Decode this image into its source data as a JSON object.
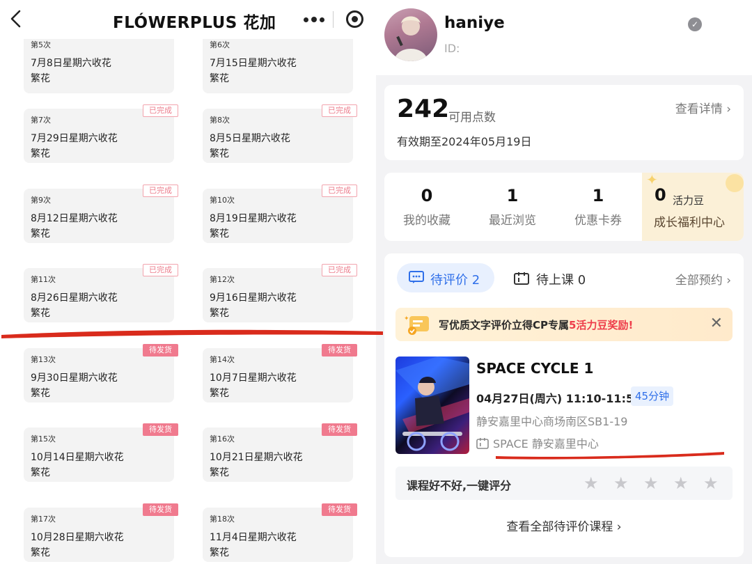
{
  "left": {
    "title": "FLÓWERPLUS 花加",
    "orders": [
      {
        "num": "第5次",
        "date": "7月8日星期六收花",
        "kind": "繁花",
        "status": ""
      },
      {
        "num": "第6次",
        "date": "7月15日星期六收花",
        "kind": "繁花",
        "status": ""
      },
      {
        "num": "第7次",
        "date": "7月29日星期六收花",
        "kind": "繁花",
        "status": "已完成"
      },
      {
        "num": "第8次",
        "date": "8月5日星期六收花",
        "kind": "繁花",
        "status": "已完成"
      },
      {
        "num": "第9次",
        "date": "8月12日星期六收花",
        "kind": "繁花",
        "status": "已完成"
      },
      {
        "num": "第10次",
        "date": "8月19日星期六收花",
        "kind": "繁花",
        "status": "已完成"
      },
      {
        "num": "第11次",
        "date": "8月26日星期六收花",
        "kind": "繁花",
        "status": "已完成"
      },
      {
        "num": "第12次",
        "date": "9月16日星期六收花",
        "kind": "繁花",
        "status": "已完成"
      },
      {
        "num": "第13次",
        "date": "9月30日星期六收花",
        "kind": "繁花",
        "status": "待发货"
      },
      {
        "num": "第14次",
        "date": "10月7日星期六收花",
        "kind": "繁花",
        "status": "待发货"
      },
      {
        "num": "第15次",
        "date": "10月14日星期六收花",
        "kind": "繁花",
        "status": "待发货"
      },
      {
        "num": "第16次",
        "date": "10月21日星期六收花",
        "kind": "繁花",
        "status": "待发货"
      },
      {
        "num": "第17次",
        "date": "10月28日星期六收花",
        "kind": "繁花",
        "status": "待发货"
      },
      {
        "num": "第18次",
        "date": "11月4日星期六收花",
        "kind": "繁花",
        "status": "待发货"
      }
    ]
  },
  "right": {
    "profile": {
      "username": "haniye",
      "id_label": "ID:"
    },
    "points": {
      "value": "242",
      "label": "可用点数",
      "expiry": "有效期至2024年05月19日",
      "detail": "查看详情 ›"
    },
    "stats": [
      {
        "value": "0",
        "label": "我的收藏"
      },
      {
        "value": "1",
        "label": "最近浏览"
      },
      {
        "value": "1",
        "label": "优惠卡券"
      }
    ],
    "growth": {
      "value": "0",
      "unit": "活力豆",
      "label": "成长福利中心"
    },
    "bookings": {
      "tab_review": "待评价 2",
      "tab_upcoming": "待上课 0",
      "all": "全部预约 ›"
    },
    "tip": {
      "text": "写优质文字评价立得CP专属",
      "highlight": "5活力豆奖励!",
      "close": "✕"
    },
    "course": {
      "name": "SPACE CYCLE 1",
      "time": "04月27日(周六) 11:10-11:55",
      "duration": "45分钟",
      "address": "静安嘉里中心商场南区SB1-19",
      "studio": "SPACE 静安嘉里中心"
    },
    "rating": {
      "question": "课程好不好,一键评分",
      "stars": 5,
      "star_glyph": "★"
    },
    "view_all": "查看全部待评价课程 ›"
  },
  "colors": {
    "accent_blue": "#2f6fe9",
    "pink": "#f07a8e",
    "highlight_red": "#ee3d4a",
    "mark_red": "#d92b1c"
  }
}
